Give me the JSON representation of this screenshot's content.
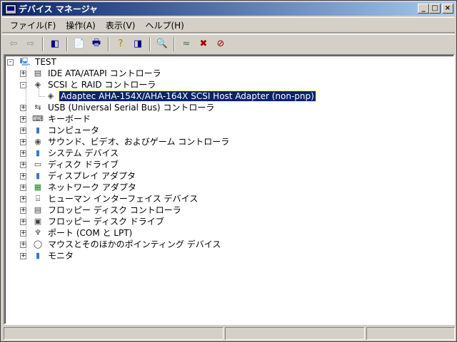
{
  "window": {
    "title": "デバイス マネージャ",
    "buttons": [
      "_",
      "□",
      "×"
    ]
  },
  "menu": [
    "ファイル(F)",
    "操作(A)",
    "表示(V)",
    "ヘルプ(H)"
  ],
  "toolbar": [
    {
      "icon": "back-icon",
      "glyph": "⇦"
    },
    {
      "icon": "forward-icon",
      "glyph": "⇨"
    },
    "sep",
    {
      "icon": "show-hide-console-tree-icon",
      "glyph": "◧"
    },
    "sep",
    {
      "icon": "properties-icon",
      "glyph": "📄"
    },
    {
      "icon": "print-icon",
      "glyph": "🖶"
    },
    "sep",
    {
      "icon": "help-icon",
      "glyph": "?"
    },
    {
      "icon": "show-hide-action-pane-icon",
      "glyph": "◨"
    },
    "sep",
    {
      "icon": "scan-hardware-icon",
      "glyph": "🔍"
    },
    "sep",
    {
      "icon": "update-driver-icon",
      "glyph": "≈"
    },
    {
      "icon": "uninstall-icon",
      "glyph": "✖"
    },
    {
      "icon": "disable-icon",
      "glyph": "⊘"
    }
  ],
  "tree": [
    {
      "label": "TEST",
      "level": 0,
      "expander": "-",
      "icon": "computer-icon",
      "glyph": "🖳"
    },
    {
      "label": "IDE ATA/ATAPI コントローラ",
      "level": 1,
      "expander": "+",
      "icon": "ide-controller-icon",
      "glyph": "▤"
    },
    {
      "label": "SCSI と RAID コントローラ",
      "level": 1,
      "expander": "-",
      "icon": "scsi-icon",
      "glyph": "◈"
    },
    {
      "label": "Adaptec AHA-154X/AHA-164X SCSI Host Adapter (non-pnp)",
      "level": 2,
      "expander": "",
      "icon": "scsi-adapter-icon",
      "glyph": "◈",
      "selected": true
    },
    {
      "label": "USB (Universal Serial Bus) コントローラ",
      "level": 1,
      "expander": "+",
      "icon": "usb-icon",
      "glyph": "⇆"
    },
    {
      "label": "キーボード",
      "level": 1,
      "expander": "+",
      "icon": "keyboard-icon",
      "glyph": "⌨"
    },
    {
      "label": "コンピュータ",
      "level": 1,
      "expander": "+",
      "icon": "computer-icon",
      "glyph": "▮"
    },
    {
      "label": "サウンド、ビデオ、およびゲーム コントローラ",
      "level": 1,
      "expander": "+",
      "icon": "sound-icon",
      "glyph": "◉"
    },
    {
      "label": "システム デバイス",
      "level": 1,
      "expander": "+",
      "icon": "system-device-icon",
      "glyph": "▮"
    },
    {
      "label": "ディスク ドライブ",
      "level": 1,
      "expander": "+",
      "icon": "disk-drive-icon",
      "glyph": "▭"
    },
    {
      "label": "ディスプレイ アダプタ",
      "level": 1,
      "expander": "+",
      "icon": "display-adapter-icon",
      "glyph": "▮"
    },
    {
      "label": "ネットワーク アダプタ",
      "level": 1,
      "expander": "+",
      "icon": "network-adapter-icon",
      "glyph": "▦"
    },
    {
      "label": "ヒューマン インターフェイス デバイス",
      "level": 1,
      "expander": "+",
      "icon": "hid-icon",
      "glyph": "⌸"
    },
    {
      "label": "フロッピー ディスク コントローラ",
      "level": 1,
      "expander": "+",
      "icon": "floppy-controller-icon",
      "glyph": "▤"
    },
    {
      "label": "フロッピー ディスク ドライブ",
      "level": 1,
      "expander": "+",
      "icon": "floppy-drive-icon",
      "glyph": "▣"
    },
    {
      "label": "ポート (COM と LPT)",
      "level": 1,
      "expander": "+",
      "icon": "port-icon",
      "glyph": "♆"
    },
    {
      "label": "マウスとそのほかのポインティング デバイス",
      "level": 1,
      "expander": "+",
      "icon": "mouse-icon",
      "glyph": "◯"
    },
    {
      "label": "モニタ",
      "level": 1,
      "expander": "+",
      "icon": "monitor-icon",
      "glyph": "▮"
    }
  ],
  "status": [
    "",
    "",
    ""
  ]
}
